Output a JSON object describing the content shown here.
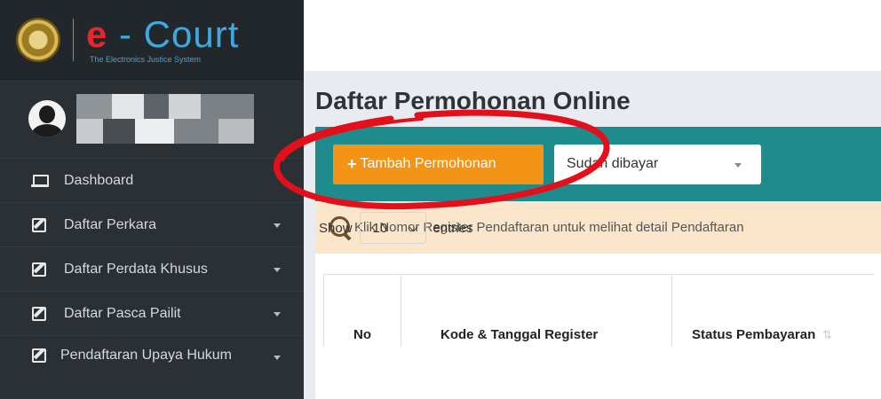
{
  "brand": {
    "title_e": "e",
    "title_rest": " - Court",
    "subtitle": "The Electronics Justice System"
  },
  "sidebar": {
    "items": [
      {
        "label": "Dashboard",
        "icon": "laptop-icon",
        "has_caret": false
      },
      {
        "label": "Daftar Perkara",
        "icon": "edit-icon",
        "has_caret": true
      },
      {
        "label": "Daftar Perdata Khusus",
        "icon": "edit-icon",
        "has_caret": true
      },
      {
        "label": "Daftar Pasca Pailit",
        "icon": "edit-icon",
        "has_caret": true
      },
      {
        "label": "Pendaftaran Upaya Hukum",
        "icon": "edit-icon",
        "has_caret": true
      }
    ]
  },
  "main": {
    "page_title": "Daftar Permohonan Online",
    "add_button_label": "Tambah Permohonan",
    "add_button_icon": "+",
    "status_filter_value": "Sudah dibayar",
    "info_text": "Klik Nomor Register Pendaftaran untuk melihat detail Pendaftaran",
    "show_label": "Show",
    "entries_value": "10",
    "entries_label": "entries",
    "table_headers": [
      "No",
      "Kode & Tanggal Register",
      "Status Pembayaran"
    ]
  },
  "colors": {
    "sidebar_bg": "#2b3035",
    "toolbar_teal": "#1e8c8c",
    "add_button_orange": "#f39417",
    "info_bg": "#fbe6cc",
    "annotation_red": "#e3101b"
  }
}
